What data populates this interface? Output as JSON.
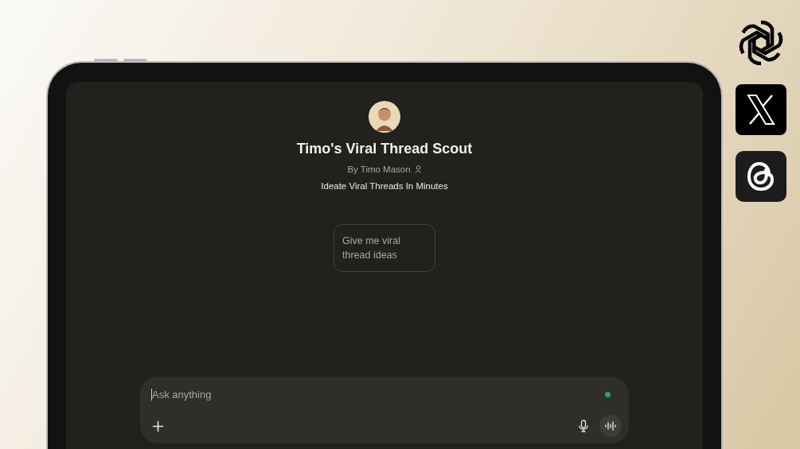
{
  "gpt": {
    "title": "Timo's Viral Thread Scout",
    "author": "By Timo Mason",
    "tagline": "Ideate Viral Threads In Minutes"
  },
  "suggestions": [
    {
      "text": "Give me viral thread ideas"
    }
  ],
  "composer": {
    "placeholder": "Ask anything"
  }
}
